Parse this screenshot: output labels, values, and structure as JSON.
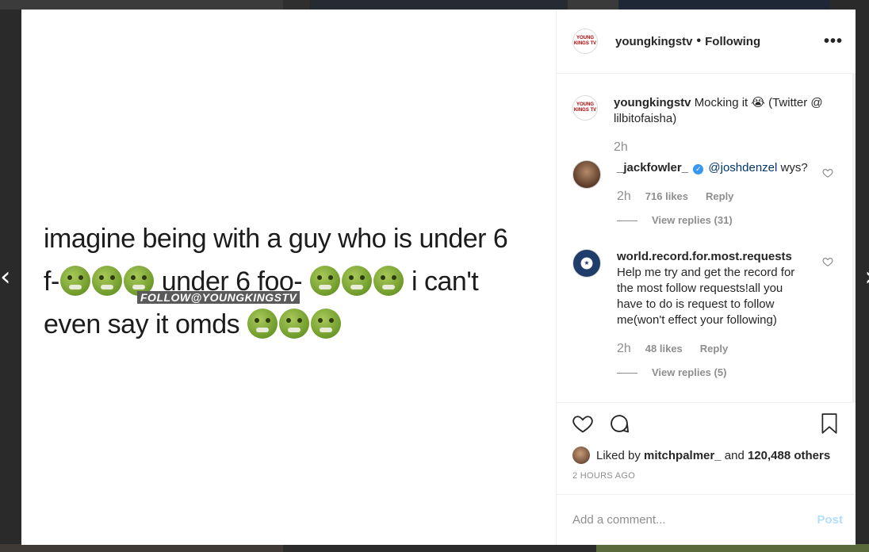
{
  "post": {
    "author": "youngkingstv",
    "follow_status": "Following",
    "avatar_logo": "YOUNG KINGS TV",
    "image_text": {
      "line1": "imagine being with a guy who is under 6",
      "line2_a": "f-",
      "line2_b": "under 6 foo-",
      "line2_c": "i can't",
      "line3_a": "even say it omds",
      "watermark": "FOLLOW@YOUNGKINGSTV"
    }
  },
  "caption": {
    "username": "youngkingstv",
    "text": "Mocking it 😭 (Twitter @ lilbitofaisha)",
    "time": "2h"
  },
  "comments": [
    {
      "username": "_jackfowler_",
      "verified": true,
      "mention": "@joshdenzel",
      "text": "wys?",
      "time": "2h",
      "likes": "716 likes",
      "reply_label": "Reply",
      "view_replies": "View replies (31)"
    },
    {
      "username": "world.record.for.most.requests",
      "text": "Help me try and get the record for the most follow requests!all you have to do is request to follow me(won't effect your following)",
      "time": "2h",
      "likes": "48 likes",
      "reply_label": "Reply",
      "view_replies": "View replies (5)"
    }
  ],
  "liked_by": {
    "prefix": "Liked by",
    "user": "mitchpalmer_",
    "and": "and",
    "others": "120,488 others"
  },
  "timestamp": "2 HOURS AGO",
  "add_comment": {
    "placeholder": "Add a comment...",
    "post_label": "Post"
  },
  "icons": {
    "more": "more-options-icon",
    "like": "heart-icon",
    "comment": "comment-icon",
    "save": "bookmark-icon",
    "prev": "chevron-left-icon",
    "next": "chevron-right-icon"
  },
  "colors": {
    "link": "#003569",
    "verified": "#3897f0",
    "muted": "#8e8e8e",
    "post_disabled": "#b2dffc"
  }
}
